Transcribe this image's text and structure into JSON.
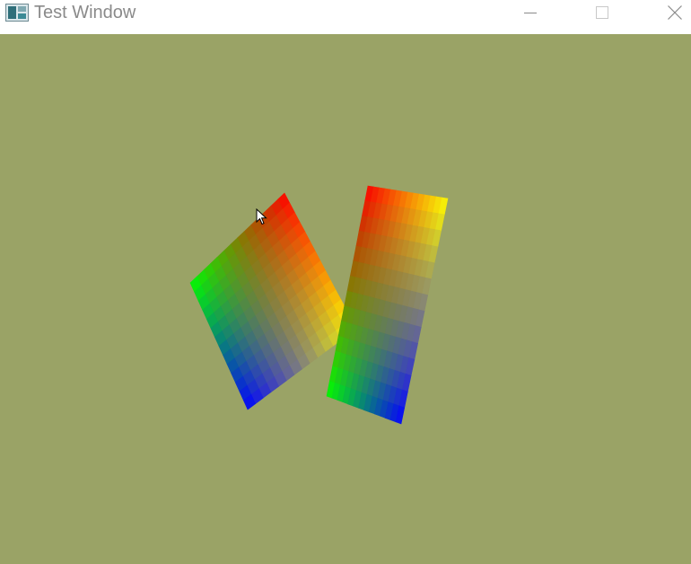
{
  "window": {
    "title": "Test Window"
  },
  "titlebar": {
    "icons": [
      "app-icon",
      "minimize-icon",
      "maximize-icon",
      "close-icon"
    ]
  },
  "scene": {
    "background_color": "#9aa366",
    "objects": [
      {
        "name": "gradient-quad-left",
        "corner_colors": [
          "#ff0000",
          "#00ff00",
          "#0000ff",
          "#ffff00"
        ]
      },
      {
        "name": "gradient-quad-right",
        "corner_colors": [
          "#ff0000",
          "#00ff00",
          "#0000ff",
          "#ffff00"
        ]
      }
    ]
  },
  "cursor": {
    "icon": "arrow-cursor-icon"
  }
}
